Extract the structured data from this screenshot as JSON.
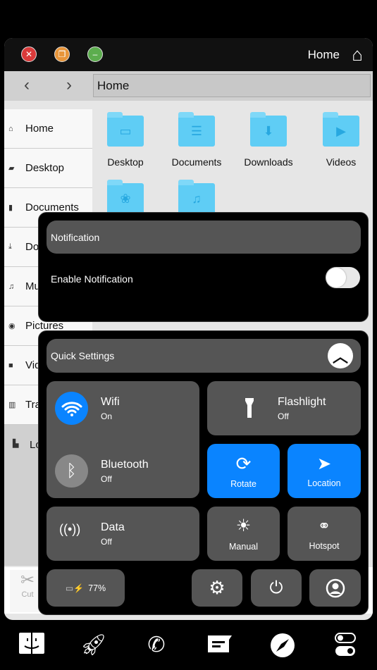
{
  "window": {
    "title": "Home",
    "address": "Home",
    "back_icon": "chevron-left",
    "forward_icon": "chevron-right"
  },
  "sidebar": {
    "items": [
      {
        "label": "Home",
        "icon": "home"
      },
      {
        "label": "Desktop",
        "icon": "folder-open"
      },
      {
        "label": "Documents",
        "icon": "file"
      },
      {
        "label": "Downloads",
        "icon": "download"
      },
      {
        "label": "Music",
        "icon": "music"
      },
      {
        "label": "Pictures",
        "icon": "camera"
      },
      {
        "label": "Videos",
        "icon": "video"
      },
      {
        "label": "Trash",
        "icon": "trash"
      },
      {
        "label": "Local",
        "icon": "drive"
      }
    ]
  },
  "folders": [
    {
      "label": "Desktop",
      "glyph": "▭"
    },
    {
      "label": "Documents",
      "glyph": "☰"
    },
    {
      "label": "Downloads",
      "glyph": "⬇"
    },
    {
      "label": "Videos",
      "glyph": "▶"
    },
    {
      "label": "",
      "glyph": "❀"
    },
    {
      "label": "",
      "glyph": "♫"
    }
  ],
  "toolbar": {
    "cut_label": "Cut"
  },
  "notification": {
    "title": "Notification",
    "enable_label": "Enable Notification",
    "enabled": false
  },
  "quick_settings": {
    "title": "Quick Settings",
    "wifi": {
      "label": "Wifi",
      "state": "On"
    },
    "bluetooth": {
      "label": "Bluetooth",
      "state": "Off"
    },
    "flashlight": {
      "label": "Flashlight",
      "state": "Off"
    },
    "rotate": {
      "label": "Rotate"
    },
    "location": {
      "label": "Location"
    },
    "data": {
      "label": "Data",
      "state": "Off"
    },
    "brightness": {
      "label": "Manual"
    },
    "hotspot": {
      "label": "Hotspot"
    },
    "battery": {
      "value": "77%"
    }
  },
  "colors": {
    "accent": "#0a84ff",
    "tile": "#555555",
    "close": "#d93a3a",
    "restore": "#e8953a",
    "minimize": "#5cad4e",
    "folder": "#5fcdf5"
  }
}
